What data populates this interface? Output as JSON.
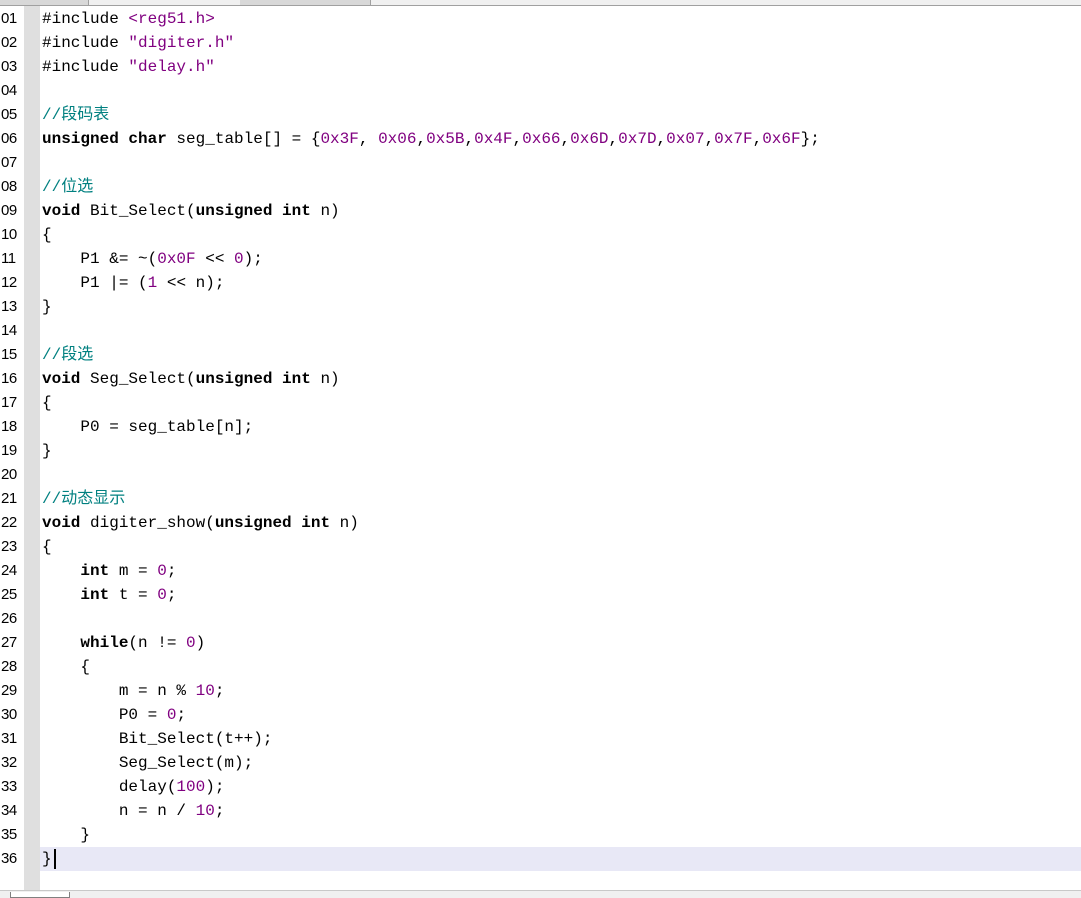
{
  "editor": {
    "lines": [
      {
        "n": "01",
        "segs": [
          [
            "pp",
            "#include "
          ],
          [
            "str",
            "<reg51.h>"
          ]
        ]
      },
      {
        "n": "02",
        "segs": [
          [
            "pp",
            "#include "
          ],
          [
            "str",
            "\"digiter.h\""
          ]
        ]
      },
      {
        "n": "03",
        "segs": [
          [
            "pp",
            "#include "
          ],
          [
            "str",
            "\"delay.h\""
          ]
        ]
      },
      {
        "n": "04",
        "segs": []
      },
      {
        "n": "05",
        "segs": [
          [
            "cmt",
            "//段码表"
          ]
        ]
      },
      {
        "n": "06",
        "segs": [
          [
            "kw",
            "unsigned char"
          ],
          [
            "pp",
            " seg_table[] = {"
          ],
          [
            "num",
            "0x3F"
          ],
          [
            "pp",
            ", "
          ],
          [
            "num",
            "0x06"
          ],
          [
            "pp",
            ","
          ],
          [
            "num",
            "0x5B"
          ],
          [
            "pp",
            ","
          ],
          [
            "num",
            "0x4F"
          ],
          [
            "pp",
            ","
          ],
          [
            "num",
            "0x66"
          ],
          [
            "pp",
            ","
          ],
          [
            "num",
            "0x6D"
          ],
          [
            "pp",
            ","
          ],
          [
            "num",
            "0x7D"
          ],
          [
            "pp",
            ","
          ],
          [
            "num",
            "0x07"
          ],
          [
            "pp",
            ","
          ],
          [
            "num",
            "0x7F"
          ],
          [
            "pp",
            ","
          ],
          [
            "num",
            "0x6F"
          ],
          [
            "pp",
            "};"
          ]
        ]
      },
      {
        "n": "07",
        "segs": []
      },
      {
        "n": "08",
        "segs": [
          [
            "cmt",
            "//位选"
          ]
        ]
      },
      {
        "n": "09",
        "segs": [
          [
            "kw",
            "void"
          ],
          [
            "pp",
            " Bit_Select("
          ],
          [
            "kw",
            "unsigned int"
          ],
          [
            "pp",
            " n)"
          ]
        ]
      },
      {
        "n": "10",
        "segs": [
          [
            "pp",
            "{"
          ]
        ]
      },
      {
        "n": "11",
        "segs": [
          [
            "pp",
            "    P1 &= ~("
          ],
          [
            "num",
            "0x0F"
          ],
          [
            "pp",
            " << "
          ],
          [
            "num",
            "0"
          ],
          [
            "pp",
            ");"
          ]
        ]
      },
      {
        "n": "12",
        "segs": [
          [
            "pp",
            "    P1 |= ("
          ],
          [
            "num",
            "1"
          ],
          [
            "pp",
            " << n);"
          ]
        ]
      },
      {
        "n": "13",
        "segs": [
          [
            "pp",
            "}"
          ]
        ]
      },
      {
        "n": "14",
        "segs": []
      },
      {
        "n": "15",
        "segs": [
          [
            "cmt",
            "//段选"
          ]
        ]
      },
      {
        "n": "16",
        "segs": [
          [
            "kw",
            "void"
          ],
          [
            "pp",
            " Seg_Select("
          ],
          [
            "kw",
            "unsigned int"
          ],
          [
            "pp",
            " n)"
          ]
        ]
      },
      {
        "n": "17",
        "segs": [
          [
            "pp",
            "{"
          ]
        ]
      },
      {
        "n": "18",
        "segs": [
          [
            "pp",
            "    P0 = seg_table[n];"
          ]
        ]
      },
      {
        "n": "19",
        "segs": [
          [
            "pp",
            "}"
          ]
        ]
      },
      {
        "n": "20",
        "segs": []
      },
      {
        "n": "21",
        "segs": [
          [
            "cmt",
            "//动态显示"
          ]
        ]
      },
      {
        "n": "22",
        "segs": [
          [
            "kw",
            "void"
          ],
          [
            "pp",
            " digiter_show("
          ],
          [
            "kw",
            "unsigned int"
          ],
          [
            "pp",
            " n)"
          ]
        ]
      },
      {
        "n": "23",
        "segs": [
          [
            "pp",
            "{"
          ]
        ]
      },
      {
        "n": "24",
        "segs": [
          [
            "pp",
            "    "
          ],
          [
            "kw",
            "int"
          ],
          [
            "pp",
            " m = "
          ],
          [
            "num",
            "0"
          ],
          [
            "pp",
            ";"
          ]
        ]
      },
      {
        "n": "25",
        "segs": [
          [
            "pp",
            "    "
          ],
          [
            "kw",
            "int"
          ],
          [
            "pp",
            " t = "
          ],
          [
            "num",
            "0"
          ],
          [
            "pp",
            ";"
          ]
        ]
      },
      {
        "n": "26",
        "segs": []
      },
      {
        "n": "27",
        "segs": [
          [
            "pp",
            "    "
          ],
          [
            "kw",
            "while"
          ],
          [
            "pp",
            "(n != "
          ],
          [
            "num",
            "0"
          ],
          [
            "pp",
            ")"
          ]
        ]
      },
      {
        "n": "28",
        "segs": [
          [
            "pp",
            "    {"
          ]
        ]
      },
      {
        "n": "29",
        "segs": [
          [
            "pp",
            "        m = n % "
          ],
          [
            "num",
            "10"
          ],
          [
            "pp",
            ";"
          ]
        ]
      },
      {
        "n": "30",
        "segs": [
          [
            "pp",
            "        P0 = "
          ],
          [
            "num",
            "0"
          ],
          [
            "pp",
            ";"
          ]
        ]
      },
      {
        "n": "31",
        "segs": [
          [
            "pp",
            "        Bit_Select(t++);"
          ]
        ]
      },
      {
        "n": "32",
        "segs": [
          [
            "pp",
            "        Seg_Select(m);"
          ]
        ]
      },
      {
        "n": "33",
        "segs": [
          [
            "pp",
            "        delay("
          ],
          [
            "num",
            "100"
          ],
          [
            "pp",
            ");"
          ]
        ]
      },
      {
        "n": "34",
        "segs": [
          [
            "pp",
            "        n = n / "
          ],
          [
            "num",
            "10"
          ],
          [
            "pp",
            ";"
          ]
        ]
      },
      {
        "n": "35",
        "segs": [
          [
            "pp",
            "    }"
          ]
        ]
      },
      {
        "n": "36",
        "segs": [
          [
            "pp",
            "}"
          ]
        ]
      }
    ],
    "current_line": "36"
  },
  "colors": {
    "keyword": "#000000",
    "string": "#800080",
    "number": "#800080",
    "comment": "#008080",
    "current_line_bg": "#e8e8f6"
  }
}
